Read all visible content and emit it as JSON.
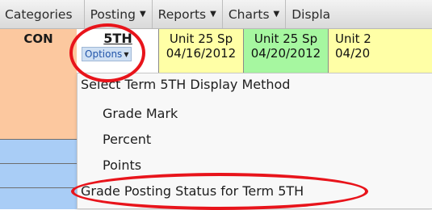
{
  "menubar": {
    "items": [
      {
        "label": "Categories",
        "dropdown": false
      },
      {
        "label": "Posting",
        "dropdown": true
      },
      {
        "label": "Reports",
        "dropdown": true
      },
      {
        "label": "Charts",
        "dropdown": true
      },
      {
        "label": "Displa",
        "dropdown": false
      }
    ]
  },
  "grid": {
    "con_label": "CON",
    "term_label": "5TH",
    "options_label": "Options",
    "assignments": [
      {
        "line1": "Unit 25 Sp",
        "line2": "04/16/2012",
        "color": "#ffffa6"
      },
      {
        "line1": "Unit 25 Sp",
        "line2": "04/20/2012",
        "color": "#a6f7a0"
      },
      {
        "line1": "Unit 2",
        "line2": "04/20",
        "color": "#ffffa6"
      }
    ]
  },
  "dropdown": {
    "title": "Select Term 5TH Display Method",
    "methods": [
      "Grade Mark",
      "Percent",
      "Points"
    ],
    "posting_status": "Grade Posting Status for Term 5TH"
  },
  "colors": {
    "highlight": "#e8141b",
    "con_top": "#fcc89f",
    "con_bottom": "#a9cdf6"
  },
  "icons": {
    "caret": "caret-down-icon"
  }
}
